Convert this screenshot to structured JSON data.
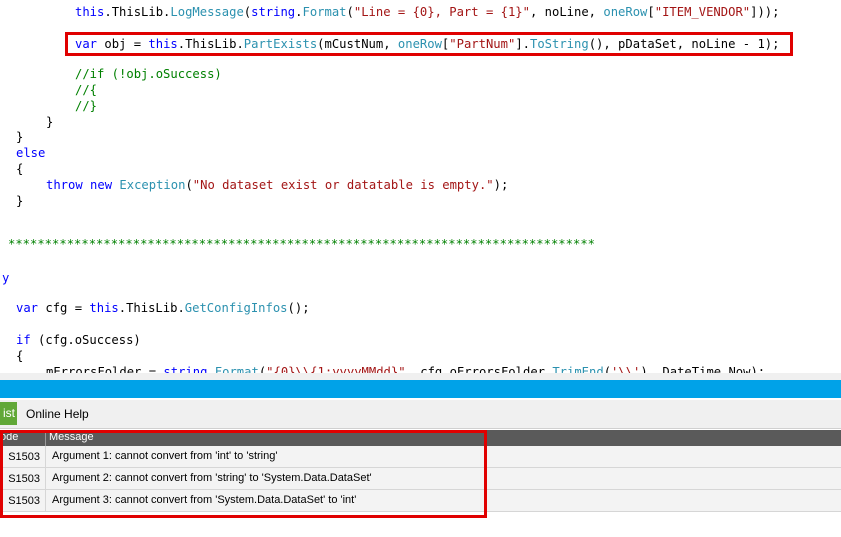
{
  "code_lines": [
    {
      "segs": [
        [
          "this",
          "kw"
        ],
        [
          ".ThisLib.",
          ""
        ],
        [
          "LogMessage",
          "mt"
        ],
        [
          "(",
          ""
        ],
        [
          "string",
          "kw"
        ],
        [
          ".",
          ""
        ],
        [
          "Format",
          "mt"
        ],
        [
          "(",
          ""
        ],
        [
          "\"Line = {0}, Part = {1}\"",
          "str"
        ],
        [
          ", noLine, ",
          ""
        ],
        [
          "oneRow",
          "mt"
        ],
        [
          "[",
          ""
        ],
        [
          "\"ITEM_VENDOR\"",
          "str"
        ],
        [
          "]));",
          ""
        ]
      ]
    },
    {
      "segs": [
        [
          "var",
          "kw"
        ],
        [
          " obj = ",
          ""
        ],
        [
          "this",
          "kw"
        ],
        [
          ".ThisLib.",
          ""
        ],
        [
          "PartExists",
          "mt"
        ],
        [
          "(mCustNum, ",
          ""
        ],
        [
          "oneRow",
          "mt"
        ],
        [
          "[",
          ""
        ],
        [
          "\"PartNum\"",
          "str"
        ],
        [
          "].",
          ""
        ],
        [
          "ToString",
          "mt"
        ],
        [
          "(), pDataSet, noLine - 1);",
          ""
        ]
      ]
    },
    {
      "segs": [
        [
          "//if (!obj.oSuccess)",
          "cm"
        ]
      ]
    },
    {
      "segs": [
        [
          "//{",
          "cm"
        ]
      ]
    },
    {
      "segs": [
        [
          "//}",
          "cm"
        ]
      ]
    },
    {
      "segs": [
        [
          "}",
          ""
        ]
      ]
    },
    {
      "segs": [
        [
          "}",
          ""
        ]
      ]
    },
    {
      "segs": [
        [
          "else",
          "kw"
        ]
      ]
    },
    {
      "segs": [
        [
          "{",
          ""
        ]
      ]
    },
    {
      "segs": [
        [
          "throw",
          "kw"
        ],
        [
          " ",
          ""
        ],
        [
          "new",
          "kw"
        ],
        [
          " ",
          ""
        ],
        [
          "Exception",
          "mt"
        ],
        [
          "(",
          ""
        ],
        [
          "\"No dataset exist or datatable is empty.\"",
          "str"
        ],
        [
          ");",
          ""
        ]
      ]
    },
    {
      "segs": [
        [
          "}",
          ""
        ]
      ]
    },
    {
      "segs": [
        [
          "********************************************************************************",
          "cm"
        ]
      ]
    },
    {
      "segs": [
        [
          "y",
          "kw"
        ]
      ]
    },
    {
      "segs": [
        [
          "var",
          "kw"
        ],
        [
          " cfg = ",
          ""
        ],
        [
          "this",
          "kw"
        ],
        [
          ".ThisLib.",
          ""
        ],
        [
          "GetConfigInfos",
          "mt"
        ],
        [
          "();",
          ""
        ]
      ]
    },
    {
      "segs": [
        [
          "if",
          "kw"
        ],
        [
          " (cfg.oSuccess)",
          ""
        ]
      ]
    },
    {
      "segs": [
        [
          "{",
          ""
        ]
      ]
    },
    {
      "segs": [
        [
          "mErrorsFolder = ",
          ""
        ],
        [
          "string",
          "kw"
        ],
        [
          ".",
          ""
        ],
        [
          "Format",
          "mt"
        ],
        [
          "(",
          ""
        ],
        [
          "\"{0}\\\\{1:yyyyMMdd}\"",
          "str"
        ],
        [
          ", cfg.oErrorsFolder.",
          ""
        ],
        [
          "TrimEnd",
          "mt"
        ],
        [
          "(",
          ""
        ],
        [
          "'\\\\'",
          "str"
        ],
        [
          "), DateTime.Now);",
          ""
        ]
      ]
    }
  ],
  "tabs": {
    "error_list": "ist",
    "online_help": "Online Help"
  },
  "grid": {
    "headers": {
      "code": "ode",
      "message": "Message"
    },
    "rows": [
      {
        "code": "S1503",
        "message": "Argument 1: cannot convert from 'int' to 'string'"
      },
      {
        "code": "S1503",
        "message": "Argument 2: cannot convert from 'string' to 'System.Data.DataSet'"
      },
      {
        "code": "S1503",
        "message": "Argument 3: cannot convert from 'System.Data.DataSet' to 'int'"
      }
    ]
  },
  "colors": {
    "accent_bar": "#00a2e8",
    "highlight_border": "#e00000",
    "tab_green": "#61a837"
  }
}
